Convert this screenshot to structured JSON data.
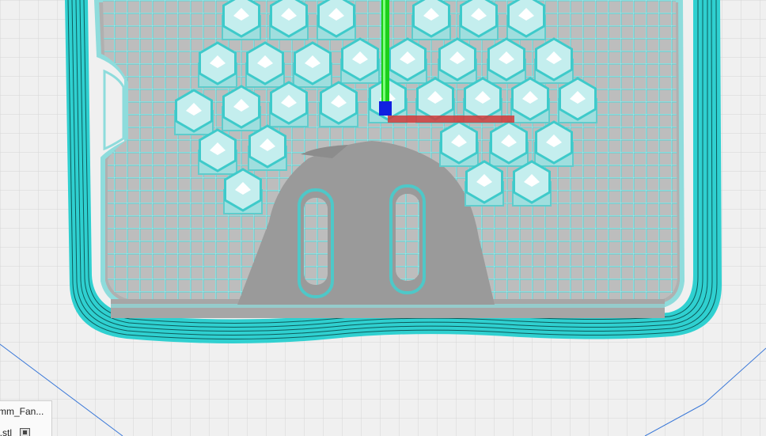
{
  "app": {
    "view": "layer-preview"
  },
  "colors": {
    "background": "#f0f0f0",
    "build_plate_grid": "#d0d0d0",
    "build_plate_grid_major": "#bdbdbd",
    "plate_boundary": "#3a78d8",
    "wall_outer": "#2fd0d0",
    "wall_inner": "#a8e6e6",
    "model_support": "#9a9a9a",
    "hex_top": "#ffffff",
    "axis_x": "#e02020",
    "axis_y": "#20d020",
    "axis_z": "#1020e0"
  },
  "object_list": {
    "items": [
      {
        "label": "mm_Fan...",
        "icon": ""
      },
      {
        "label": "l.stl",
        "icon": "file-stl-icon"
      }
    ]
  },
  "axes_gizmo": {
    "icon": "xyz-axes-icon"
  }
}
